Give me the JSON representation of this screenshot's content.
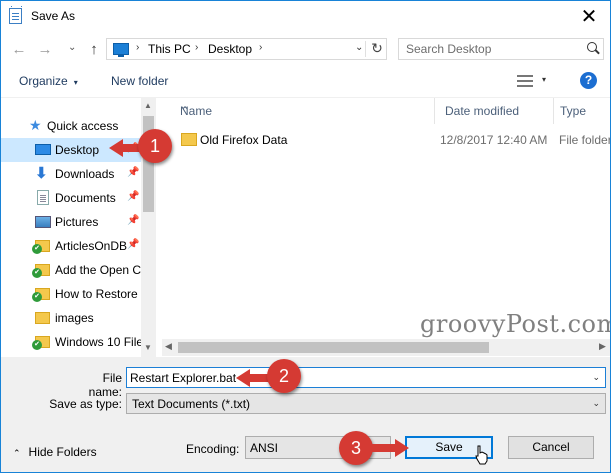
{
  "window": {
    "title": "Save As",
    "close_glyph": "✕"
  },
  "nav": {
    "back": "←",
    "forward": "→",
    "up": "↑",
    "recent_caret": "⌄",
    "breadcrumb": [
      "This PC",
      "Desktop"
    ],
    "separator": "›",
    "refresh": "↻",
    "address_caret": "⌄",
    "search_placeholder": "Search Desktop"
  },
  "toolbar": {
    "organize": "Organize",
    "organize_caret": "▾",
    "new_folder": "New folder",
    "view_caret": "▾",
    "help": "?"
  },
  "navpane": {
    "items": [
      {
        "label": "Quick access",
        "icon": "star-icon",
        "pinned": false
      },
      {
        "label": "Desktop",
        "icon": "desktop-icon",
        "pinned": true,
        "selected": true
      },
      {
        "label": "Downloads",
        "icon": "download-icon",
        "pinned": true
      },
      {
        "label": "Documents",
        "icon": "documents-icon",
        "pinned": true
      },
      {
        "label": "Pictures",
        "icon": "pictures-icon",
        "pinned": true
      },
      {
        "label": "ArticlesOnDB",
        "icon": "folder-check-icon",
        "pinned": true
      },
      {
        "label": "Add the Open C",
        "icon": "folder-check-icon",
        "pinned": false
      },
      {
        "label": "How to Restore t",
        "icon": "folder-check-icon",
        "pinned": false
      },
      {
        "label": "images",
        "icon": "folder-icon",
        "pinned": false
      },
      {
        "label": "Windows 10 File",
        "icon": "folder-check-icon",
        "pinned": false
      }
    ],
    "pin_glyph": "📌"
  },
  "filelist": {
    "columns": [
      "Name",
      "Date modified",
      "Type"
    ],
    "rows": [
      {
        "name": "Old Firefox Data",
        "date": "12/8/2017 12:40 AM",
        "type": "File folder"
      }
    ]
  },
  "watermark": "groovyPost.com",
  "form": {
    "filename_label": "File name:",
    "filename_value": "Restart Explorer.bat",
    "savetype_label": "Save as type:",
    "savetype_value": "Text Documents (*.txt)",
    "encoding_label": "Encoding:",
    "encoding_value": "ANSI"
  },
  "footer": {
    "hide_folders": "Hide Folders",
    "hide_chev": "⌃",
    "save": "Save",
    "cancel": "Cancel"
  },
  "annotations": [
    {
      "number": "1"
    },
    {
      "number": "2"
    },
    {
      "number": "3"
    }
  ],
  "colors": {
    "accent": "#0078d7",
    "selection": "#cce8ff",
    "annotation": "#d53a33"
  }
}
